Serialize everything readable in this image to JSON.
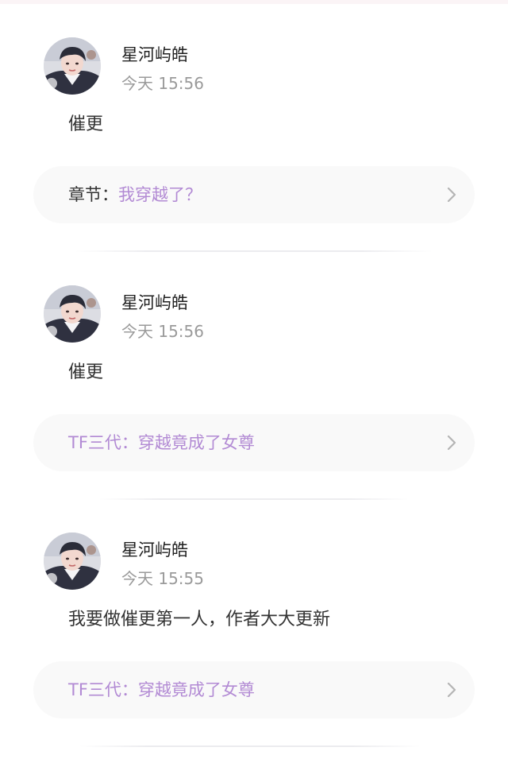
{
  "colors": {
    "accent": "#b28ad4",
    "text_primary": "#1f1f1f",
    "text_secondary": "#9a9a9a",
    "card_bg": "#f9f9f9"
  },
  "comments": [
    {
      "username": "星河屿皓",
      "time": "今天 15:56",
      "text": "催更",
      "chapter_prefix": "章节：",
      "chapter_title": "我穿越了？",
      "chevron_icon": "chevron-right-icon"
    },
    {
      "username": "星河屿皓",
      "time": "今天 15:56",
      "text": "催更",
      "chapter_prefix": "",
      "chapter_title": "TF三代：穿越竟成了女尊",
      "chevron_icon": "chevron-right-icon"
    },
    {
      "username": "星河屿皓",
      "time": "今天 15:55",
      "text": "我要做催更第一人，作者大大更新",
      "chapter_prefix": "",
      "chapter_title": "TF三代：穿越竟成了女尊",
      "chevron_icon": "chevron-right-icon"
    }
  ]
}
